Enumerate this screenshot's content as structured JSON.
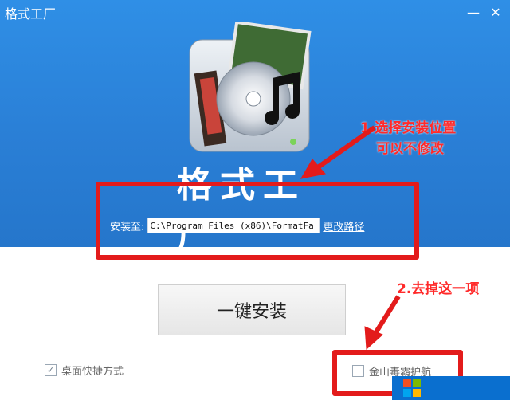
{
  "window": {
    "title": "格式工厂",
    "minimize_icon": "minimize-icon",
    "close_icon": "close-icon"
  },
  "brand": {
    "name": "格式工厂"
  },
  "install": {
    "label": "安装至:",
    "path": "C:\\Program Files (x86)\\FormatFa",
    "change_link": "更改路径"
  },
  "install_button": {
    "label": "一键安装"
  },
  "options": [
    {
      "label": "桌面快捷方式",
      "checked": true
    },
    {
      "label": "金山毒霸护航",
      "checked": false
    }
  ],
  "annotations": {
    "note1_line1": "1.选择安装位置",
    "note1_line2": "可以不修改",
    "note2": "2.去掉这一项",
    "color": "#e31b1b"
  },
  "colors": {
    "hero_bg": "#2a7fd6",
    "button_bg": "#eeeeee"
  }
}
